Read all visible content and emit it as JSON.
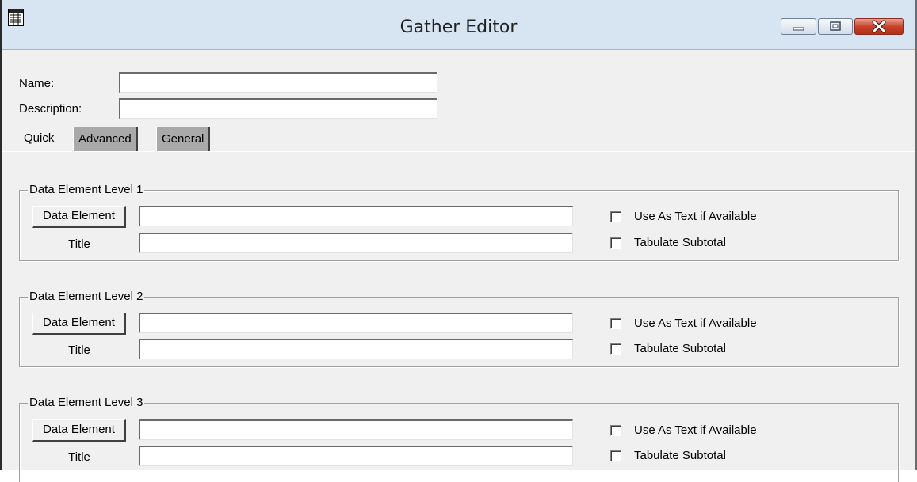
{
  "window": {
    "title": "Gather Editor",
    "icon": "app-window-icon"
  },
  "form": {
    "name_label": "Name:",
    "name_value": "",
    "description_label": "Description:",
    "description_value": ""
  },
  "tabs": [
    {
      "label": "Quick",
      "active": true
    },
    {
      "label": "Advanced",
      "active": false
    },
    {
      "label": "General",
      "active": false
    }
  ],
  "levels": [
    {
      "title": "Data Element Level 1",
      "data_element_button": "Data Element",
      "data_element_value": "",
      "title_label": "Title",
      "title_value": "",
      "use_as_text_label": "Use As Text if Available",
      "use_as_text_checked": false,
      "tabulate_label": "Tabulate Subtotal",
      "tabulate_checked": false
    },
    {
      "title": "Data Element Level 2",
      "data_element_button": "Data Element",
      "data_element_value": "",
      "title_label": "Title",
      "title_value": "",
      "use_as_text_label": "Use As Text if Available",
      "use_as_text_checked": false,
      "tabulate_label": "Tabulate Subtotal",
      "tabulate_checked": false
    },
    {
      "title": "Data Element Level 3",
      "data_element_button": "Data Element",
      "data_element_value": "",
      "title_label": "Title",
      "title_value": "",
      "use_as_text_label": "Use As Text if Available",
      "use_as_text_checked": false,
      "tabulate_label": "Tabulate Subtotal",
      "tabulate_checked": false
    }
  ],
  "colors": {
    "titlebar": "#d7e4f2",
    "client_background": "#f0f0f0",
    "close_button": "#c8432c",
    "inactive_tab": "#a9a9a9"
  }
}
